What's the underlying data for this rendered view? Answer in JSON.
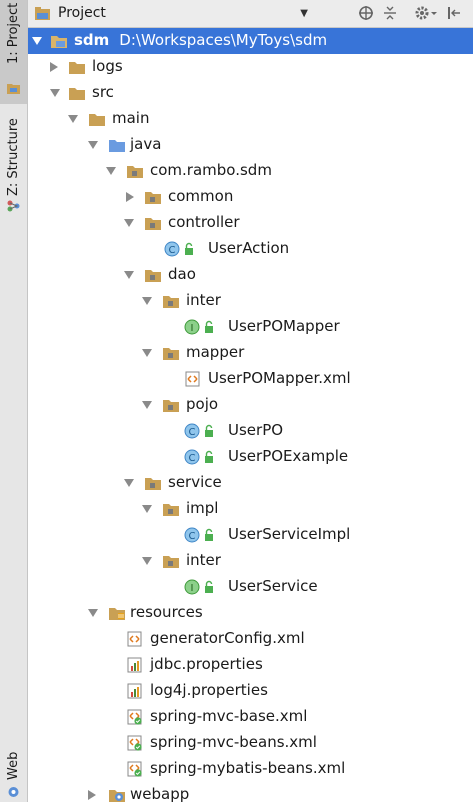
{
  "sidebar": {
    "tabs": [
      {
        "label": "1: Project",
        "active": true
      },
      {
        "label": "Z: Structure"
      },
      {
        "label": "Web"
      }
    ]
  },
  "header": {
    "title": "Project"
  },
  "tree": {
    "root": {
      "name": "sdm",
      "path": "D:\\Workspaces\\MyToys\\sdm"
    },
    "logs": "logs",
    "src": "src",
    "main": "main",
    "java": "java",
    "pkg": "com.rambo.sdm",
    "common": "common",
    "controller": "controller",
    "user_action": "UserAction",
    "dao": "dao",
    "dao_inter": "inter",
    "user_po_mapper": "UserPOMapper",
    "mapper": "mapper",
    "user_po_mapper_xml": "UserPOMapper.xml",
    "pojo": "pojo",
    "user_po": "UserPO",
    "user_po_example": "UserPOExample",
    "service": "service",
    "impl": "impl",
    "user_service_impl": "UserServiceImpl",
    "service_inter": "inter",
    "user_service": "UserService",
    "resources": "resources",
    "generator_config": "generatorConfig.xml",
    "jdbc_properties": "jdbc.properties",
    "log4j_properties": "log4j.properties",
    "spring_mvc_base": "spring-mvc-base.xml",
    "spring_mvc_beans": "spring-mvc-beans.xml",
    "spring_mybatis_beans": "spring-mybatis-beans.xml",
    "webapp": "webapp"
  },
  "colors": {
    "selection": "#3874d8",
    "folder": "#c9a054",
    "class_icon": "#8fc5ec",
    "interface_icon": "#8cd08a"
  }
}
